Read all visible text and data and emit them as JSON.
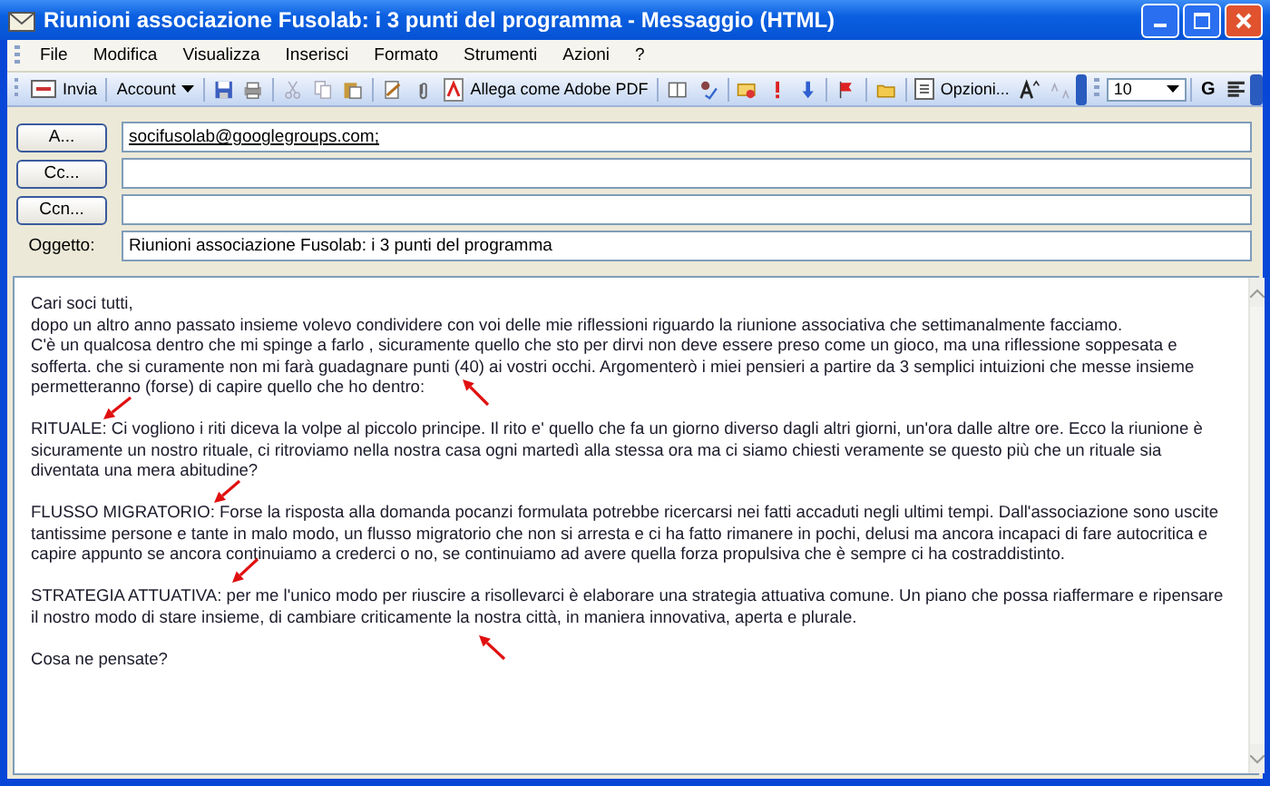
{
  "window": {
    "title": "Riunioni associazione Fusolab: i 3 punti del programma - Messaggio (HTML)"
  },
  "menu": [
    "File",
    "Modifica",
    "Visualizza",
    "Inserisci",
    "Formato",
    "Strumenti",
    "Azioni",
    "?"
  ],
  "toolbar": {
    "send": "Invia",
    "account": "Account",
    "pdf": "Allega come Adobe PDF",
    "options": "Opzioni...",
    "font_size": "10",
    "bold": "G"
  },
  "fields": [
    {
      "kind": "button",
      "label": "A...",
      "value": "socifusolab@googlegroups.com;"
    },
    {
      "kind": "button",
      "label": "Cc..."
    },
    {
      "kind": "button",
      "label": "Ccn..."
    },
    {
      "kind": "label",
      "label": "Oggetto:",
      "value": "Riunioni associazione Fusolab: i 3 punti del programma"
    }
  ],
  "body": [
    [
      "Cari soci tutti,",
      "dopo un altro anno passato insieme volevo condividere con voi delle mie riflessioni riguardo la riunione associativa che settimanalmente facciamo.",
      "C'è un qualcosa dentro che mi spinge a farlo , sicuramente quello che sto per dirvi non deve essere preso come un gioco, ma una riflessione soppesata e",
      "sofferta. che si curamente non mi farà  guadagnare punti (40) ai vostri occhi. Argomenterò i miei pensieri a partire da 3 semplici intuizioni che messe insieme",
      "permetteranno (forse) di capire quello che ho dentro:"
    ],
    [
      "RITUALE: Ci vogliono i riti diceva la volpe al piccolo principe. Il rito e' quello che fa un giorno diverso dagli altri giorni, un'ora dalle altre ore. Ecco la riunione è",
      "sicuramente un nostro rituale, ci ritroviamo nella nostra casa ogni martedì alla stessa ora ma ci siamo chiesti veramente se questo più che un rituale sia",
      "diventata una mera abitudine?"
    ],
    [
      "FLUSSO MIGRATORIO: Forse la risposta alla domanda pocanzi formulata potrebbe ricercarsi nei fatti accaduti negli ultimi tempi. Dall'associazione sono uscite",
      "tantissime persone e tante in malo modo, un flusso migratorio che non si arresta e ci ha fatto rimanere in pochi, delusi ma ancora incapaci di fare autocritica e",
      "capire appunto se ancora continuiamo a crederci o no, se continuiamo ad avere quella forza propulsiva che è sempre ci ha costraddistinto."
    ],
    [
      "STRATEGIA ATTUATIVA: per me l'unico modo per riuscire a risollevarci è elaborare una strategia attuativa comune. Un piano che possa riaffermare e ripensare",
      "il nostro modo di stare insieme, di cambiare criticamente la nostra città, in maniera innovativa, aperta e plurale."
    ],
    [
      "Cosa ne pensate?"
    ]
  ]
}
